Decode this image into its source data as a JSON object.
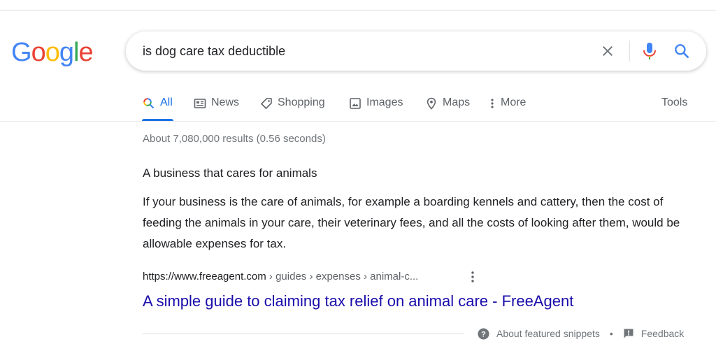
{
  "logo": {
    "letters": [
      "G",
      "o",
      "o",
      "g",
      "l",
      "e"
    ],
    "colors": [
      "#4285F4",
      "#EA4335",
      "#FBBC05",
      "#4285F4",
      "#34A853",
      "#EA4335"
    ]
  },
  "search": {
    "query": "is dog care tax deductible"
  },
  "tabs": [
    {
      "label": "All",
      "icon": "search-icon",
      "active": true
    },
    {
      "label": "News",
      "icon": "news-icon"
    },
    {
      "label": "Shopping",
      "icon": "tag-icon"
    },
    {
      "label": "Images",
      "icon": "image-icon"
    },
    {
      "label": "Maps",
      "icon": "map-pin-icon"
    },
    {
      "label": "More",
      "icon": "more-vert-icon"
    }
  ],
  "tools_label": "Tools",
  "stats": "About 7,080,000 results (0.56 seconds)",
  "snippet": {
    "heading": "A business that cares for animals",
    "body": "If your business is the care of animals, for example a boarding kennels and cattery, then the cost of feeding the animals in your care, their veterinary fees, and all the costs of looking after them, would be allowable expenses for tax."
  },
  "result": {
    "host": "https://www.freeagent.com",
    "path": " › guides › expenses › animal-c...",
    "title": "A simple guide to claiming tax relief on animal care - FreeAgent"
  },
  "footer": {
    "about_label": "About featured snippets",
    "separator": "•",
    "feedback_label": "Feedback"
  },
  "colors": {
    "accent": "#1a73e8",
    "link": "#1a0dab",
    "muted": "#70757a"
  }
}
